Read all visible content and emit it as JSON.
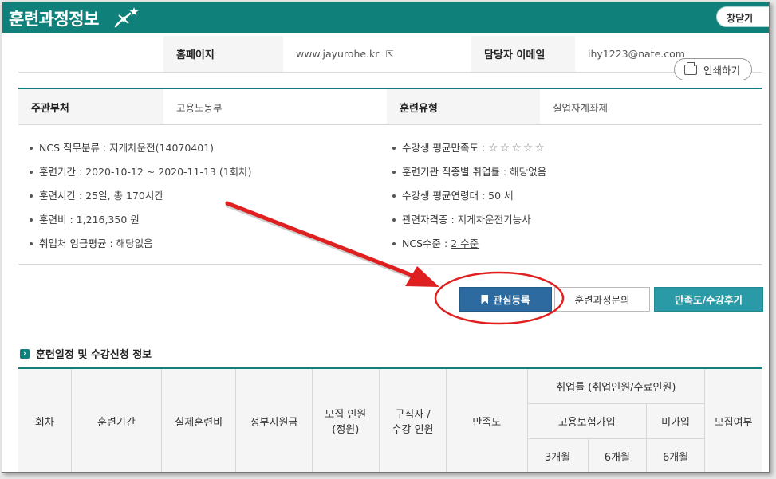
{
  "header": {
    "title": "훈련과정정보",
    "close_label": "창닫기"
  },
  "top_row": {
    "homepage_label": "홈페이지",
    "homepage_value": "www.jayurohe.kr",
    "email_label": "담당자 이메일",
    "email_value": "ihy1223@nate.com"
  },
  "print_label": "인쇄하기",
  "org_row": {
    "dept_label": "주관부처",
    "dept_value": "고용노동부",
    "type_label": "훈련유형",
    "type_value": "실업자계좌제"
  },
  "left_info": [
    {
      "label": "NCS 직무분류",
      "value": " : 지게차운전(14070401)"
    },
    {
      "label": "훈련기간",
      "value": " : 2020-10-12 ~ 2020-11-13 (1회차)"
    },
    {
      "label": "훈련시간",
      "value": " : 25일, 총 170시간"
    },
    {
      "label": "훈련비",
      "value": " : 1,216,350 원"
    },
    {
      "label": "취업처 임금평균",
      "value": " : 해당없음"
    }
  ],
  "right_info": [
    {
      "label": "수강생 평균만족도",
      "value": " : ",
      "stars": "☆☆☆☆☆"
    },
    {
      "label": "훈련기관 직종별 취업률",
      "value": " : 해당없음"
    },
    {
      "label": "수강생 평균연령대",
      "value": " : 50 세"
    },
    {
      "label": "관련자격증",
      "value": " : 지게차운전기능사"
    },
    {
      "label": "NCS수준",
      "value": " : ",
      "link": "2 수준"
    }
  ],
  "buttons": {
    "favorite": "관심등록",
    "inquiry": "훈련과정문의",
    "review": "만족도/수강후기"
  },
  "section": {
    "icon_glyph": "›",
    "title": "훈련일정 및 수강신청 정보"
  },
  "table_headers": {
    "round": "회차",
    "period": "훈련기간",
    "actual_fee": "실제훈련비",
    "gov_support": "정부지원금",
    "recruit_1": "모집 인원",
    "recruit_2": "(정원)",
    "seeker_1": "구직자 /",
    "seeker_2": "수강 인원",
    "satisfaction": "만족도",
    "employment_rate": "취업률 (취업인원/수료인원)",
    "insured": "고용보험가입",
    "uninsured": "미가입",
    "recruiting": "모집여부",
    "m3": "3개월",
    "m6": "6개월",
    "m6b": "6개월"
  },
  "colors": {
    "brand": "#10807a",
    "favorite_button": "#2d6aa0",
    "review_button": "#2a9aa6",
    "annotation_red": "#e02020"
  }
}
